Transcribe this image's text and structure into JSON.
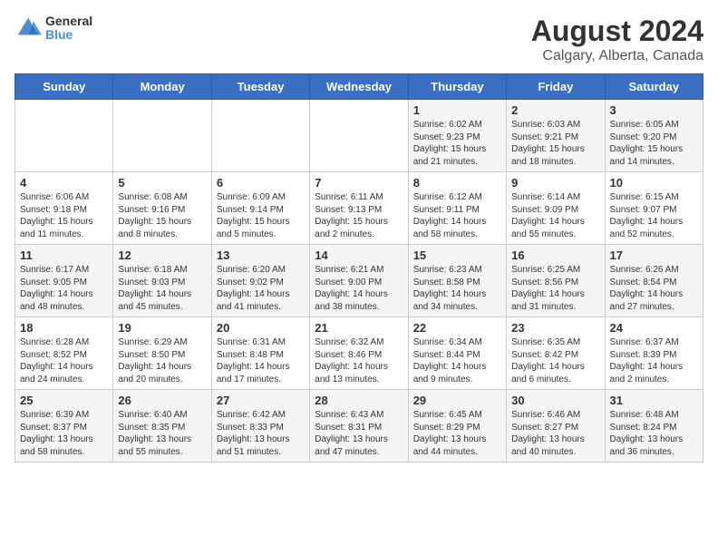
{
  "header": {
    "logo_general": "General",
    "logo_blue": "Blue",
    "title": "August 2024",
    "subtitle": "Calgary, Alberta, Canada"
  },
  "calendar": {
    "weekdays": [
      "Sunday",
      "Monday",
      "Tuesday",
      "Wednesday",
      "Thursday",
      "Friday",
      "Saturday"
    ],
    "weeks": [
      [
        {
          "day": "",
          "info": ""
        },
        {
          "day": "",
          "info": ""
        },
        {
          "day": "",
          "info": ""
        },
        {
          "day": "",
          "info": ""
        },
        {
          "day": "1",
          "info": "Sunrise: 6:02 AM\nSunset: 9:23 PM\nDaylight: 15 hours\nand 21 minutes."
        },
        {
          "day": "2",
          "info": "Sunrise: 6:03 AM\nSunset: 9:21 PM\nDaylight: 15 hours\nand 18 minutes."
        },
        {
          "day": "3",
          "info": "Sunrise: 6:05 AM\nSunset: 9:20 PM\nDaylight: 15 hours\nand 14 minutes."
        }
      ],
      [
        {
          "day": "4",
          "info": "Sunrise: 6:06 AM\nSunset: 9:18 PM\nDaylight: 15 hours\nand 11 minutes."
        },
        {
          "day": "5",
          "info": "Sunrise: 6:08 AM\nSunset: 9:16 PM\nDaylight: 15 hours\nand 8 minutes."
        },
        {
          "day": "6",
          "info": "Sunrise: 6:09 AM\nSunset: 9:14 PM\nDaylight: 15 hours\nand 5 minutes."
        },
        {
          "day": "7",
          "info": "Sunrise: 6:11 AM\nSunset: 9:13 PM\nDaylight: 15 hours\nand 2 minutes."
        },
        {
          "day": "8",
          "info": "Sunrise: 6:12 AM\nSunset: 9:11 PM\nDaylight: 14 hours\nand 58 minutes."
        },
        {
          "day": "9",
          "info": "Sunrise: 6:14 AM\nSunset: 9:09 PM\nDaylight: 14 hours\nand 55 minutes."
        },
        {
          "day": "10",
          "info": "Sunrise: 6:15 AM\nSunset: 9:07 PM\nDaylight: 14 hours\nand 52 minutes."
        }
      ],
      [
        {
          "day": "11",
          "info": "Sunrise: 6:17 AM\nSunset: 9:05 PM\nDaylight: 14 hours\nand 48 minutes."
        },
        {
          "day": "12",
          "info": "Sunrise: 6:18 AM\nSunset: 9:03 PM\nDaylight: 14 hours\nand 45 minutes."
        },
        {
          "day": "13",
          "info": "Sunrise: 6:20 AM\nSunset: 9:02 PM\nDaylight: 14 hours\nand 41 minutes."
        },
        {
          "day": "14",
          "info": "Sunrise: 6:21 AM\nSunset: 9:00 PM\nDaylight: 14 hours\nand 38 minutes."
        },
        {
          "day": "15",
          "info": "Sunrise: 6:23 AM\nSunset: 8:58 PM\nDaylight: 14 hours\nand 34 minutes."
        },
        {
          "day": "16",
          "info": "Sunrise: 6:25 AM\nSunset: 8:56 PM\nDaylight: 14 hours\nand 31 minutes."
        },
        {
          "day": "17",
          "info": "Sunrise: 6:26 AM\nSunset: 8:54 PM\nDaylight: 14 hours\nand 27 minutes."
        }
      ],
      [
        {
          "day": "18",
          "info": "Sunrise: 6:28 AM\nSunset: 8:52 PM\nDaylight: 14 hours\nand 24 minutes."
        },
        {
          "day": "19",
          "info": "Sunrise: 6:29 AM\nSunset: 8:50 PM\nDaylight: 14 hours\nand 20 minutes."
        },
        {
          "day": "20",
          "info": "Sunrise: 6:31 AM\nSunset: 8:48 PM\nDaylight: 14 hours\nand 17 minutes."
        },
        {
          "day": "21",
          "info": "Sunrise: 6:32 AM\nSunset: 8:46 PM\nDaylight: 14 hours\nand 13 minutes."
        },
        {
          "day": "22",
          "info": "Sunrise: 6:34 AM\nSunset: 8:44 PM\nDaylight: 14 hours\nand 9 minutes."
        },
        {
          "day": "23",
          "info": "Sunrise: 6:35 AM\nSunset: 8:42 PM\nDaylight: 14 hours\nand 6 minutes."
        },
        {
          "day": "24",
          "info": "Sunrise: 6:37 AM\nSunset: 8:39 PM\nDaylight: 14 hours\nand 2 minutes."
        }
      ],
      [
        {
          "day": "25",
          "info": "Sunrise: 6:39 AM\nSunset: 8:37 PM\nDaylight: 13 hours\nand 58 minutes."
        },
        {
          "day": "26",
          "info": "Sunrise: 6:40 AM\nSunset: 8:35 PM\nDaylight: 13 hours\nand 55 minutes."
        },
        {
          "day": "27",
          "info": "Sunrise: 6:42 AM\nSunset: 8:33 PM\nDaylight: 13 hours\nand 51 minutes."
        },
        {
          "day": "28",
          "info": "Sunrise: 6:43 AM\nSunset: 8:31 PM\nDaylight: 13 hours\nand 47 minutes."
        },
        {
          "day": "29",
          "info": "Sunrise: 6:45 AM\nSunset: 8:29 PM\nDaylight: 13 hours\nand 44 minutes."
        },
        {
          "day": "30",
          "info": "Sunrise: 6:46 AM\nSunset: 8:27 PM\nDaylight: 13 hours\nand 40 minutes."
        },
        {
          "day": "31",
          "info": "Sunrise: 6:48 AM\nSunset: 8:24 PM\nDaylight: 13 hours\nand 36 minutes."
        }
      ]
    ]
  }
}
